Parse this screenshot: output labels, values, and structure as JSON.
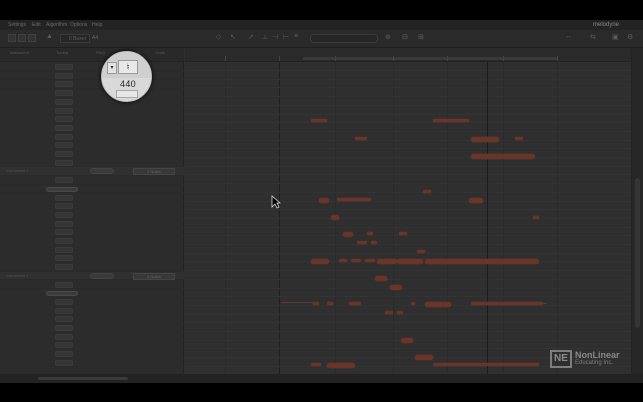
{
  "menubar": {
    "items": [
      "Settings",
      "Edit",
      "Algorithm",
      "Options",
      "Help"
    ],
    "app_title": "melodyne"
  },
  "toolbar": {
    "tempo_field": "0 Boxer",
    "reference_pitch_prefix": "A4",
    "search_placeholder": ""
  },
  "left_panel": {
    "headers": [
      "Instrument",
      "Tuning",
      "Pitch",
      "Mode",
      "Scale"
    ],
    "group_rows": [
      {
        "name": "Instrument 1",
        "mode": "2 Notes"
      },
      {
        "name": "Instrument 2",
        "mode": "2 Notes"
      },
      {
        "name": "Instrument 3",
        "mode": "2 Notes"
      }
    ]
  },
  "magnifier": {
    "dropdown_glyph": "▾",
    "tuning_glyph": "♮",
    "value": "440"
  },
  "colors": {
    "note_fill": "#6a3528",
    "background": "#2f2f2f",
    "panel": "#2c2c2c"
  },
  "watermark": {
    "logo": "NE",
    "line1": "NonLinear",
    "line2": "Educating Inc."
  }
}
